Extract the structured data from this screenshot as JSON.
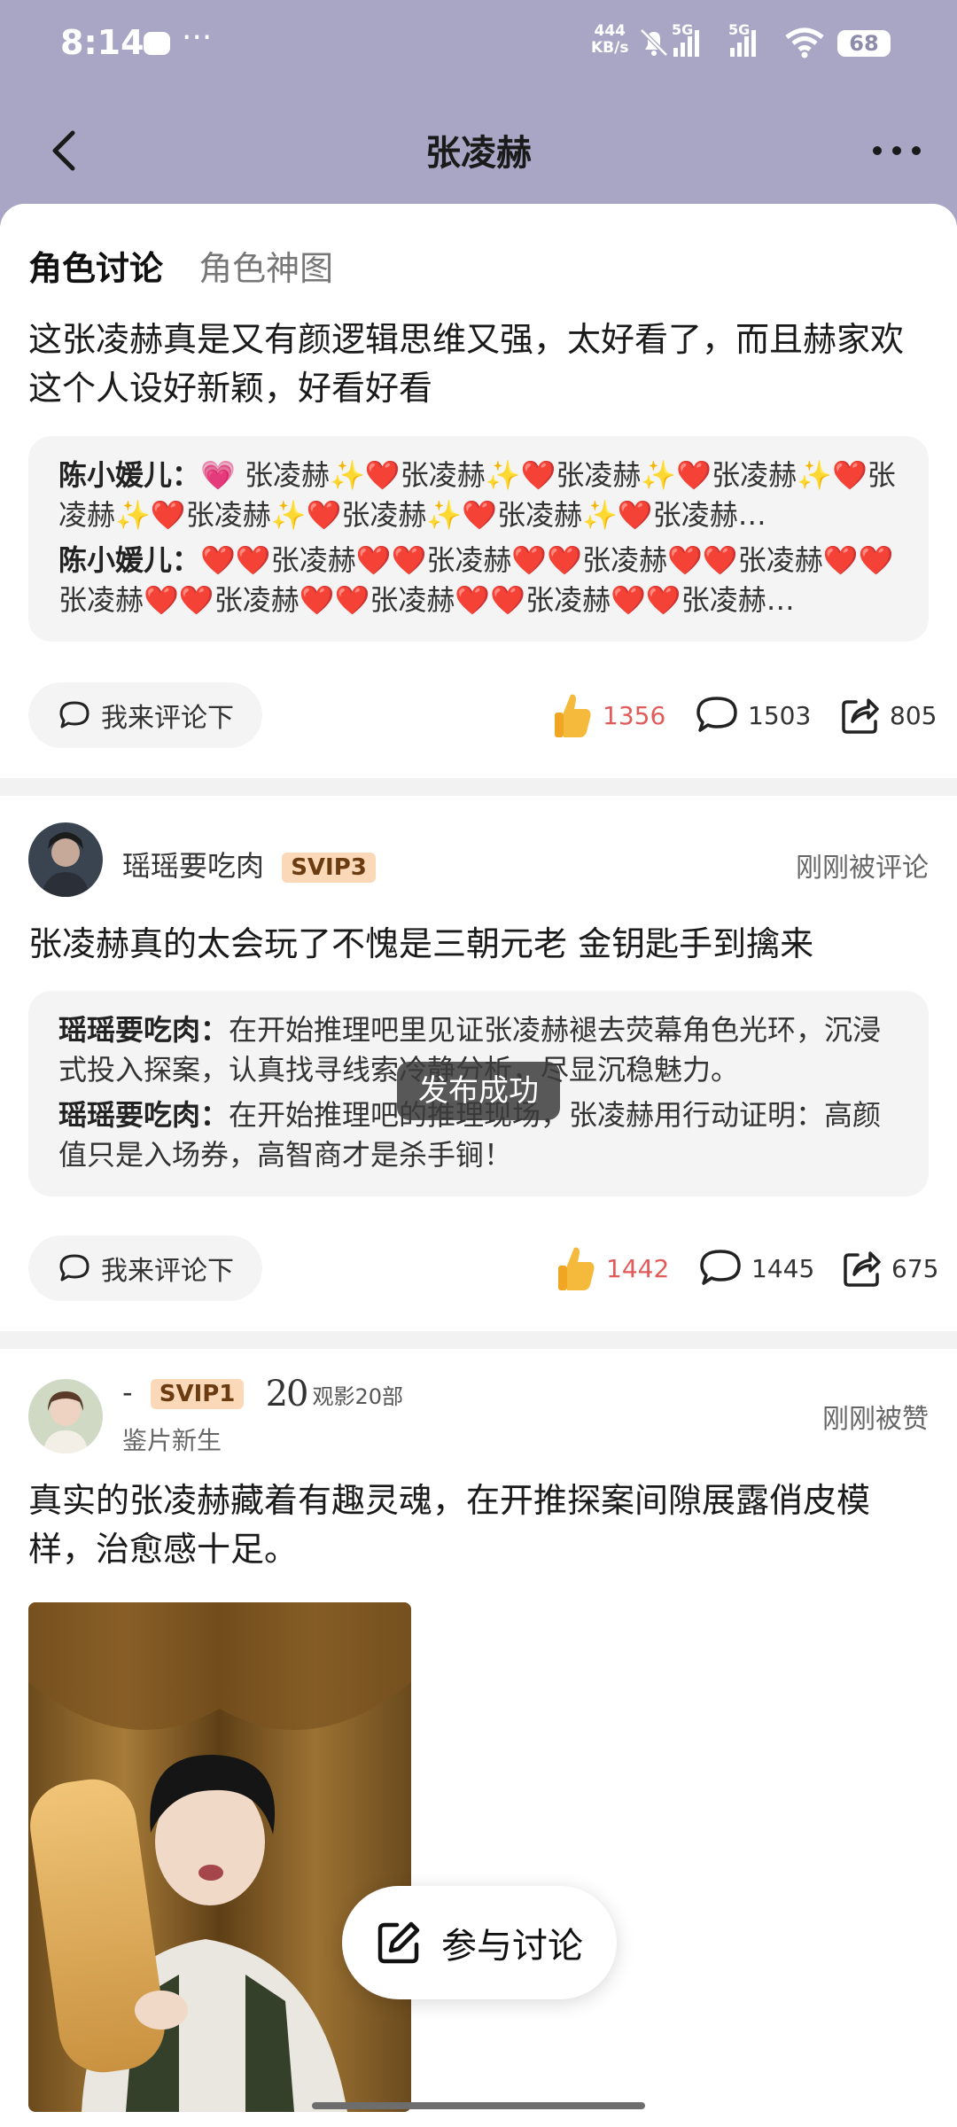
{
  "status_bar": {
    "time": "8:14",
    "dots": "···",
    "speed_value": "444",
    "speed_unit": "KB/s",
    "network_1": "5G",
    "network_2": "5G",
    "battery": "68"
  },
  "header": {
    "title": "张凌赫"
  },
  "tabs": [
    "角色讨论",
    "角色神图"
  ],
  "posts": [
    {
      "text": "这张凌赫真是又有颜逻辑思维又强，太好看了，而且赫家欢这个人设好新颖，好看好看",
      "comments": [
        {
          "name": "陈小媛儿：",
          "text": "💗 张凌赫✨❤️张凌赫✨❤️张凌赫✨❤️张凌赫✨❤️张凌赫✨❤️张凌赫✨❤️张凌赫✨❤️张凌赫✨❤️张凌赫…"
        },
        {
          "name": "陈小媛儿：",
          "text": "❤️❤️张凌赫❤️❤️张凌赫❤️❤️张凌赫❤️❤️张凌赫❤️❤️张凌赫❤️❤️张凌赫❤️❤️张凌赫❤️❤️张凌赫❤️❤️张凌赫…"
        }
      ],
      "comment_button": "我来评论下",
      "likes": "1356",
      "comment_count": "1503",
      "shares": "805"
    },
    {
      "username": "瑶瑶要吃肉",
      "vip": "SVIP3",
      "status": "刚刚被评论",
      "text": "张凌赫真的太会玩了不愧是三朝元老 金钥匙手到擒来",
      "comments": [
        {
          "name": "瑶瑶要吃肉：",
          "text": "在开始推理吧里见证张凌赫褪去荧幕角色光环，沉浸式投入探案，认真找寻线索冷静分析，尽显沉稳魅力。"
        },
        {
          "name": "瑶瑶要吃肉：",
          "text": "在开始推理吧的推理现场，张凌赫用行动证明：高颜值只是入场券，高智商才是杀手锏！"
        }
      ],
      "comment_button": "我来评论下",
      "likes": "1442",
      "comment_count": "1445",
      "shares": "675"
    },
    {
      "username": "-",
      "vip": "SVIP1",
      "watch_number": "20",
      "watch_label": "观影20部",
      "subtitle": "鉴片新生",
      "status": "刚刚被赞",
      "text": "真实的张凌赫藏着有趣灵魂，在开推探案间隙展露俏皮模样，治愈感十足。"
    }
  ],
  "toast": "发布成功",
  "fab_label": "参与讨论",
  "colors": {
    "header_bg": "#a8a6c4",
    "like_red": "#e25b5b",
    "vip_bg": "#fbd9b8"
  }
}
